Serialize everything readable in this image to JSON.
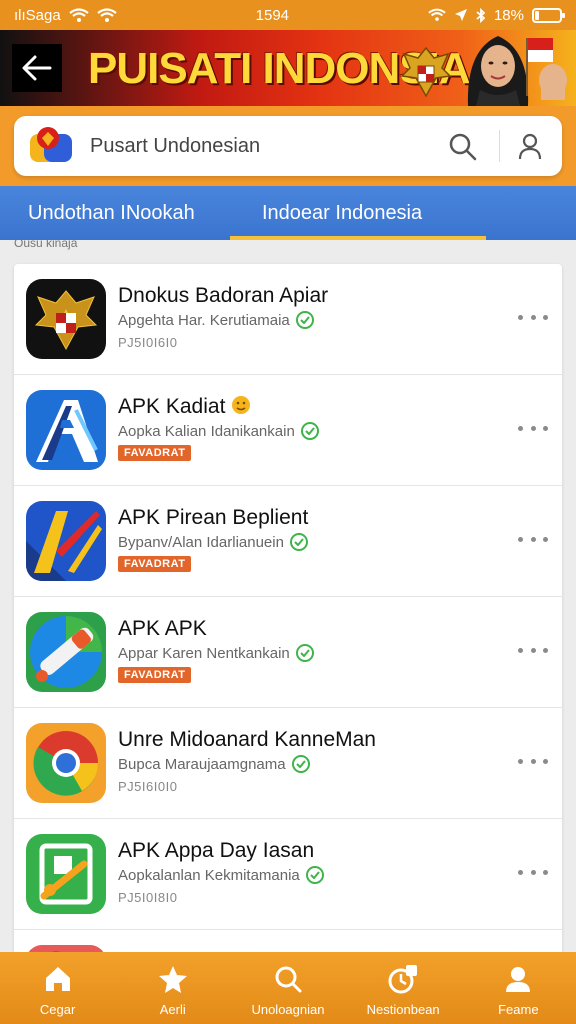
{
  "status_bar": {
    "carrier": "ılıSaga",
    "time": "1594",
    "battery": "18%",
    "battery_level": 0.18
  },
  "banner": {
    "title": "PUISATI INDONSIA"
  },
  "search": {
    "value": "Pusart Undonesian"
  },
  "tabs": [
    {
      "label": "Undothan INookah"
    },
    {
      "label": "Indoear Indonesia",
      "active": true
    }
  ],
  "sub_label": "Ousu kinaja",
  "apps": [
    {
      "title": "Dnokus Badoran Apiar",
      "subtitle": "Apgehta Har. Kerutiamaia",
      "meta": "PJ5I0I6I0",
      "badge": null,
      "icon": "garuda-emblem-icon"
    },
    {
      "title": "APK Kadiat",
      "subtitle": "Aopka Kalian Idanikankain",
      "meta": null,
      "badge": "FAVADRAT",
      "icon": "blue-a-app-icon"
    },
    {
      "title": "APK Pirean Beplient",
      "subtitle": "Bypanv/Alan Idarlianuein",
      "meta": null,
      "badge": "FAVADRAT",
      "icon": "yellow-blue-app-icon"
    },
    {
      "title": "APK APK",
      "subtitle": "Appar Karen Nentkankain",
      "meta": null,
      "badge": "FAVADRAT",
      "icon": "pencil-app-icon"
    },
    {
      "title": "Unre Midoanard KanneMan",
      "subtitle": "Bupca Maraujaamgnama",
      "meta": "PJ5I6I0I0",
      "badge": null,
      "icon": "chrome-app-icon"
    },
    {
      "title": "APK Appa Day Iasan",
      "subtitle": "Aopkalanlan Kekmitamania",
      "meta": "PJ5I0I8I0",
      "badge": null,
      "icon": "green-tool-app-icon"
    }
  ],
  "bottom_nav": [
    {
      "label": "Cegar",
      "icon": "home-icon"
    },
    {
      "label": "Aerli",
      "icon": "star-icon"
    },
    {
      "label": "Unoloagnian",
      "icon": "search-icon"
    },
    {
      "label": "Nestionbean",
      "icon": "notification-icon"
    },
    {
      "label": "Feame",
      "icon": "profile-icon"
    }
  ],
  "colors": {
    "accent": "#f29a2a",
    "tab_bar": "#3a74cf",
    "badge": "#e2662a",
    "check": "#3fb44a"
  }
}
